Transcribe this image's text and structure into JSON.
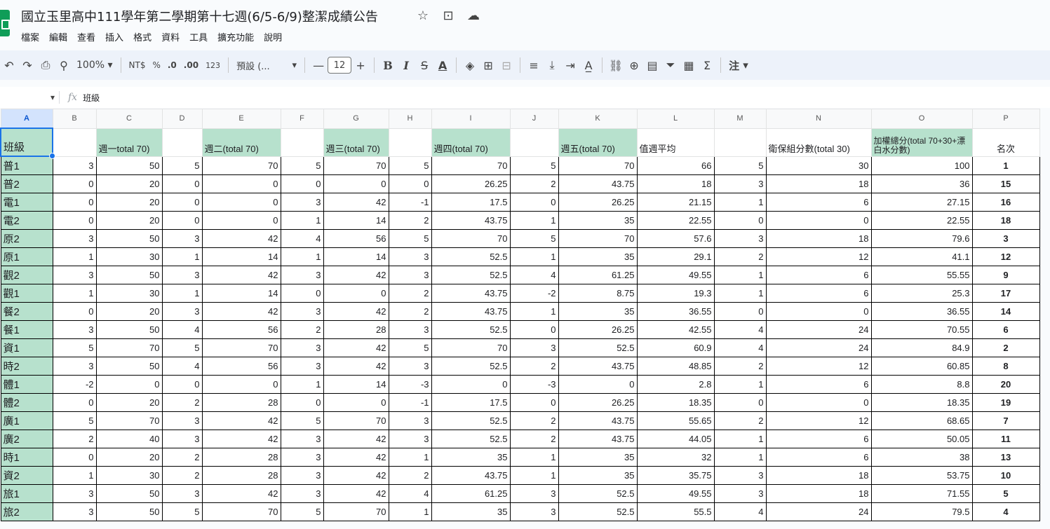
{
  "document": {
    "title": "國立玉里高中111學年第二學期第十七週(6/5-6/9)整潔成績公告"
  },
  "menu": [
    "檔案",
    "編輯",
    "查看",
    "插入",
    "格式",
    "資料",
    "工具",
    "擴充功能",
    "說明"
  ],
  "toolbar": {
    "zoom": "100%",
    "currency": "NT$",
    "percent": "%",
    "decrease_decimal": ".0",
    "increase_decimal": ".00",
    "format_123": "123",
    "font": "預設 (...",
    "font_size": "12",
    "notes": "注"
  },
  "formula_bar": {
    "name_box": "",
    "content": "班級"
  },
  "columns": [
    "A",
    "B",
    "C",
    "D",
    "E",
    "F",
    "G",
    "H",
    "I",
    "J",
    "K",
    "L",
    "M",
    "N",
    "O",
    "P"
  ],
  "header_row": [
    "班級",
    "",
    "週一total 70)",
    "",
    "週二(total 70)",
    "",
    "週三(total 70)",
    "",
    "週四(total 70)",
    "",
    "週五(total 70)",
    "值週平均",
    "",
    "衛保組分數(total 30)",
    "加權總分(total 70+30+漂白水分數)",
    "名次"
  ],
  "rows": [
    [
      "普1",
      "3",
      "50",
      "5",
      "70",
      "5",
      "70",
      "5",
      "70",
      "5",
      "70",
      "66",
      "5",
      "30",
      "100",
      "1"
    ],
    [
      "普2",
      "0",
      "20",
      "0",
      "0",
      "0",
      "0",
      "0",
      "26.25",
      "2",
      "43.75",
      "18",
      "3",
      "18",
      "36",
      "15"
    ],
    [
      "電1",
      "0",
      "20",
      "0",
      "0",
      "3",
      "42",
      "-1",
      "17.5",
      "0",
      "26.25",
      "21.15",
      "1",
      "6",
      "27.15",
      "16"
    ],
    [
      "電2",
      "0",
      "20",
      "0",
      "0",
      "1",
      "14",
      "2",
      "43.75",
      "1",
      "35",
      "22.55",
      "0",
      "0",
      "22.55",
      "18"
    ],
    [
      "原2",
      "3",
      "50",
      "3",
      "42",
      "4",
      "56",
      "5",
      "70",
      "5",
      "70",
      "57.6",
      "3",
      "18",
      "79.6",
      "3"
    ],
    [
      "原1",
      "1",
      "30",
      "1",
      "14",
      "1",
      "14",
      "3",
      "52.5",
      "1",
      "35",
      "29.1",
      "2",
      "12",
      "41.1",
      "12"
    ],
    [
      "觀2",
      "3",
      "50",
      "3",
      "42",
      "3",
      "42",
      "3",
      "52.5",
      "4",
      "61.25",
      "49.55",
      "1",
      "6",
      "55.55",
      "9"
    ],
    [
      "觀1",
      "1",
      "30",
      "1",
      "14",
      "0",
      "0",
      "2",
      "43.75",
      "-2",
      "8.75",
      "19.3",
      "1",
      "6",
      "25.3",
      "17"
    ],
    [
      "餐2",
      "0",
      "20",
      "3",
      "42",
      "3",
      "42",
      "2",
      "43.75",
      "1",
      "35",
      "36.55",
      "0",
      "0",
      "36.55",
      "14"
    ],
    [
      "餐1",
      "3",
      "50",
      "4",
      "56",
      "2",
      "28",
      "3",
      "52.5",
      "0",
      "26.25",
      "42.55",
      "4",
      "24",
      "70.55",
      "6"
    ],
    [
      "資1",
      "5",
      "70",
      "5",
      "70",
      "3",
      "42",
      "5",
      "70",
      "3",
      "52.5",
      "60.9",
      "4",
      "24",
      "84.9",
      "2"
    ],
    [
      "時2",
      "3",
      "50",
      "4",
      "56",
      "3",
      "42",
      "3",
      "52.5",
      "2",
      "43.75",
      "48.85",
      "2",
      "12",
      "60.85",
      "8"
    ],
    [
      "體1",
      "-2",
      "0",
      "0",
      "0",
      "1",
      "14",
      "-3",
      "0",
      "-3",
      "0",
      "2.8",
      "1",
      "6",
      "8.8",
      "20"
    ],
    [
      "體2",
      "0",
      "20",
      "2",
      "28",
      "0",
      "0",
      "-1",
      "17.5",
      "0",
      "26.25",
      "18.35",
      "0",
      "0",
      "18.35",
      "19"
    ],
    [
      "廣1",
      "5",
      "70",
      "3",
      "42",
      "5",
      "70",
      "3",
      "52.5",
      "2",
      "43.75",
      "55.65",
      "2",
      "12",
      "68.65",
      "7"
    ],
    [
      "廣2",
      "2",
      "40",
      "3",
      "42",
      "3",
      "42",
      "3",
      "52.5",
      "2",
      "43.75",
      "44.05",
      "1",
      "6",
      "50.05",
      "11"
    ],
    [
      "時1",
      "0",
      "20",
      "2",
      "28",
      "3",
      "42",
      "1",
      "35",
      "1",
      "35",
      "32",
      "1",
      "6",
      "38",
      "13"
    ],
    [
      "資2",
      "1",
      "30",
      "2",
      "28",
      "3",
      "42",
      "2",
      "43.75",
      "1",
      "35",
      "35.75",
      "3",
      "18",
      "53.75",
      "10"
    ],
    [
      "旅1",
      "3",
      "50",
      "3",
      "42",
      "3",
      "42",
      "4",
      "61.25",
      "3",
      "52.5",
      "49.55",
      "3",
      "18",
      "71.55",
      "5"
    ],
    [
      "旅2",
      "3",
      "50",
      "5",
      "70",
      "5",
      "70",
      "1",
      "35",
      "3",
      "52.5",
      "55.5",
      "4",
      "24",
      "79.5",
      "4"
    ]
  ]
}
